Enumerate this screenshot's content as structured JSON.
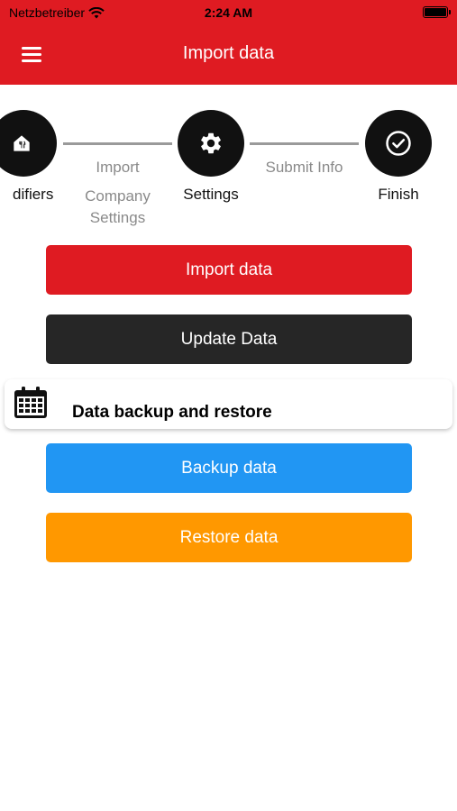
{
  "status_bar": {
    "carrier": "Netzbetreiber",
    "time": "2:24 AM"
  },
  "header": {
    "title": "Import data",
    "menu_icon": "hamburger-menu-icon"
  },
  "stepper": {
    "steps": [
      {
        "label": "difiers",
        "icon": "restaurant-icon"
      },
      {
        "label": "Settings",
        "icon": "gear-icon"
      },
      {
        "label": "Finish",
        "icon": "check-circle-icon"
      }
    ],
    "connectors": [
      {
        "line1": "Import",
        "line2": "Company",
        "line3": "Settings"
      },
      {
        "line1": "Submit Info"
      }
    ]
  },
  "actions": {
    "import_label": "Import data",
    "update_label": "Update Data"
  },
  "backup_section": {
    "title": "Data backup and restore",
    "icon": "calendar-icon",
    "backup_label": "Backup data",
    "restore_label": "Restore data"
  },
  "colors": {
    "brand_red": "#df1b22",
    "dark": "#262626",
    "blue": "#2196f3",
    "orange": "#ff9800"
  }
}
